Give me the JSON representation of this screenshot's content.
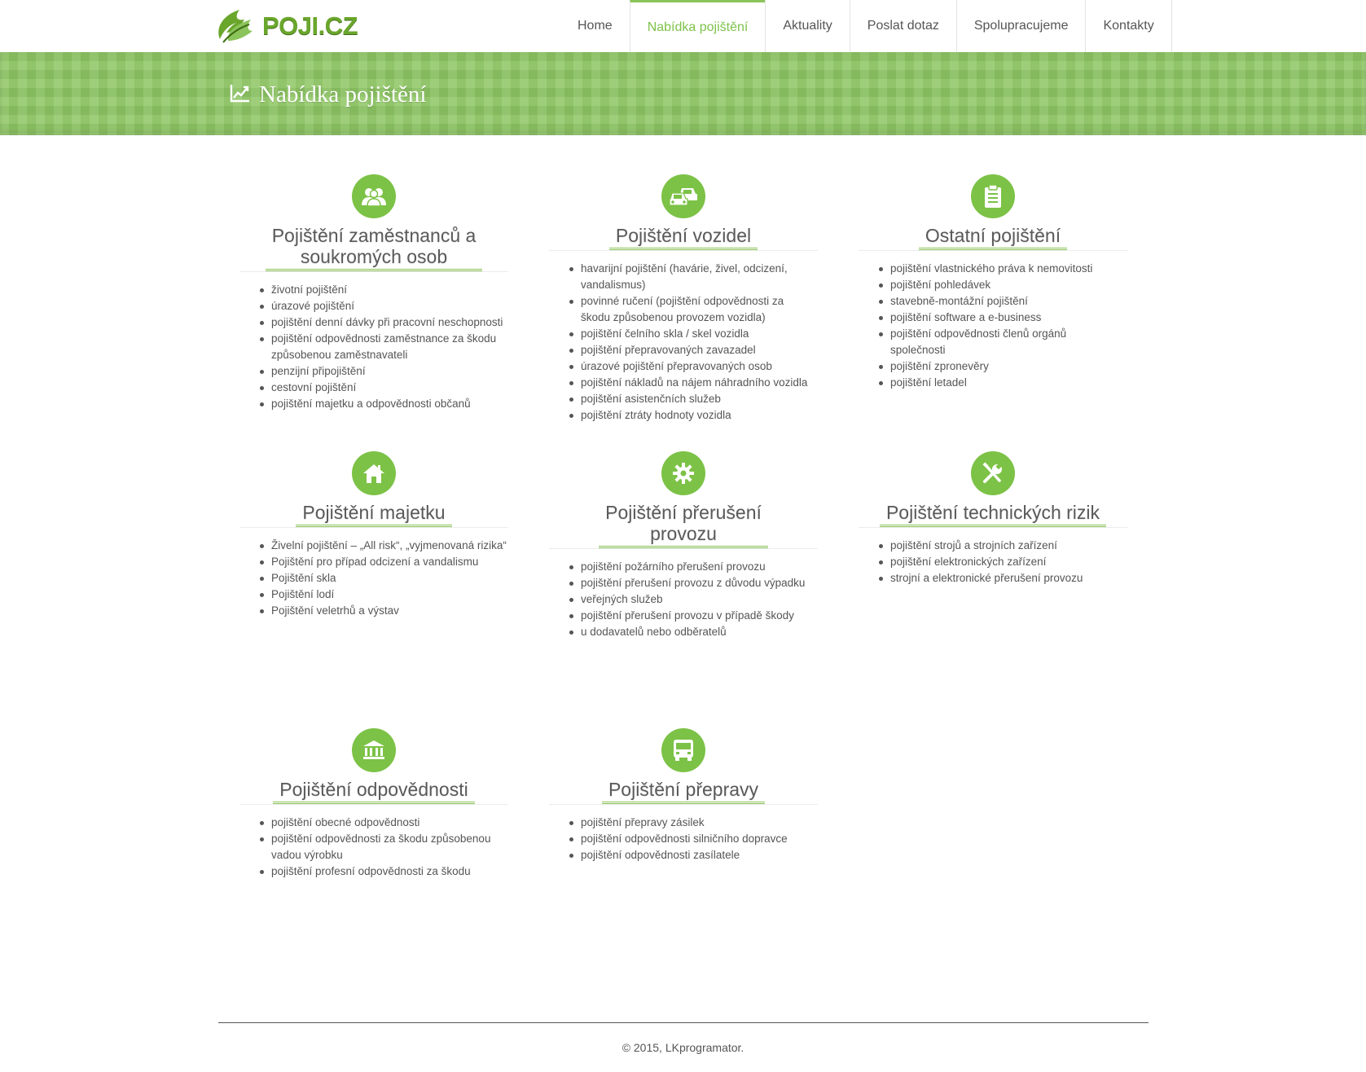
{
  "brand": {
    "name": "POJI.CZ",
    "accent": "#7cc246"
  },
  "nav": {
    "items": [
      "Home",
      "Nabídka pojištění",
      "Aktuality",
      "Poslat dotaz",
      "Spolupracujeme",
      "Kontakty"
    ],
    "active_index": 1
  },
  "banner": {
    "title": "Nabídka pojištění",
    "icon": "chart-line-icon"
  },
  "sections": [
    {
      "icon": "users-icon",
      "title_lines": [
        "Pojištění zaměstnanců a",
        "soukromých osob"
      ],
      "items": [
        {
          "text": "životní pojištění",
          "bullet": true
        },
        {
          "text": "úrazové pojištění",
          "bullet": true
        },
        {
          "text": "pojištění denní dávky při pracovní neschopnosti",
          "bullet": true
        },
        {
          "text": "pojištění odpovědnosti zaměstnance za škodu",
          "bullet": true
        },
        {
          "text": "způsobenou zaměstnavateli",
          "bullet": false
        },
        {
          "text": "penzijní připojištění",
          "bullet": true
        },
        {
          "text": "cestovní pojištění",
          "bullet": true
        },
        {
          "text": "pojištění majetku a odpovědnosti občanů",
          "bullet": true
        }
      ]
    },
    {
      "icon": "car-icon",
      "title_lines": [
        "Pojištění vozidel"
      ],
      "items": [
        {
          "text": "havarijní pojištění (havárie, živel, odcizení,",
          "bullet": true
        },
        {
          "text": "vandalismus)",
          "bullet": false
        },
        {
          "text": "povinné ručení (pojištění odpovědnosti za",
          "bullet": true
        },
        {
          "text": "škodu způsobenou provozem vozidla)",
          "bullet": false
        },
        {
          "text": "pojištění čelního skla / skel vozidla",
          "bullet": true
        },
        {
          "text": "pojištění přepravovaných zavazadel",
          "bullet": true
        },
        {
          "text": "úrazové pojištění přepravovaných osob",
          "bullet": true
        },
        {
          "text": "pojištění nákladů na nájem náhradního vozidla",
          "bullet": true
        },
        {
          "text": "pojištění asistenčních služeb",
          "bullet": true
        },
        {
          "text": "pojištění ztráty hodnoty vozidla",
          "bullet": true
        }
      ]
    },
    {
      "icon": "clipboard-icon",
      "title_lines": [
        "Ostatní pojištění"
      ],
      "items": [
        {
          "text": "pojištění vlastnického práva k nemovitosti",
          "bullet": true
        },
        {
          "text": "pojištění pohledávek",
          "bullet": true
        },
        {
          "text": "stavebně-montážní pojištění",
          "bullet": true
        },
        {
          "text": "pojištění software a e-business",
          "bullet": true
        },
        {
          "text": "pojištění odpovědnosti členů orgánů",
          "bullet": true
        },
        {
          "text": "společnosti",
          "bullet": false
        },
        {
          "text": "pojištění zpronevěry",
          "bullet": true
        },
        {
          "text": "pojištění letadel",
          "bullet": true
        }
      ]
    },
    {
      "icon": "home-icon",
      "title_lines": [
        "Pojištění majetku"
      ],
      "items": [
        {
          "text": "Živelní pojištění – „All risk“, „vyjmenovaná rizika“",
          "bullet": true
        },
        {
          "text": "Pojištění pro případ odcizení a vandalismu",
          "bullet": true
        },
        {
          "text": "Pojištění skla",
          "bullet": true
        },
        {
          "text": "Pojištění lodí",
          "bullet": true
        },
        {
          "text": "Pojištění veletrhů a výstav",
          "bullet": true
        }
      ]
    },
    {
      "icon": "gear-icon",
      "title_lines": [
        "Pojištění přerušení",
        "provozu"
      ],
      "items": [
        {
          "text": "pojištění požárního přerušení provozu",
          "bullet": true
        },
        {
          "text": "pojištění přerušení provozu z důvodu výpadku",
          "bullet": true
        },
        {
          "text": "veřejných služeb",
          "bullet": true
        },
        {
          "text": "pojištění přerušení provozu v případě škody",
          "bullet": true
        },
        {
          "text": "u dodavatelů nebo odběratelů",
          "bullet": true
        }
      ]
    },
    {
      "icon": "wrench-icon",
      "title_lines": [
        "Pojištění technických rizik"
      ],
      "items": [
        {
          "text": "pojištění strojů a strojních zařízení",
          "bullet": true
        },
        {
          "text": "pojištění elektronických zařízení",
          "bullet": true
        },
        {
          "text": "strojní a elektronické přerušení provozu",
          "bullet": true
        }
      ]
    },
    {
      "icon": "bank-icon",
      "title_lines": [
        "Pojištění odpovědnosti"
      ],
      "items": [
        {
          "text": "pojištění obecné odpovědnosti",
          "bullet": true
        },
        {
          "text": "pojištění odpovědnosti za škodu způsobenou",
          "bullet": true
        },
        {
          "text": "vadou výrobku",
          "bullet": false
        },
        {
          "text": "pojištění profesní odpovědnosti za škodu",
          "bullet": true
        }
      ]
    },
    {
      "icon": "truck-icon",
      "title_lines": [
        "Pojištění přepravy"
      ],
      "items": [
        {
          "text": "pojištění přepravy zásilek",
          "bullet": true
        },
        {
          "text": "pojištění odpovědnosti silničního dopravce",
          "bullet": true
        },
        {
          "text": "pojištění odpovědnosti zasílatele",
          "bullet": true
        }
      ]
    }
  ],
  "footer": {
    "text": "© 2015, LKprogramator."
  }
}
